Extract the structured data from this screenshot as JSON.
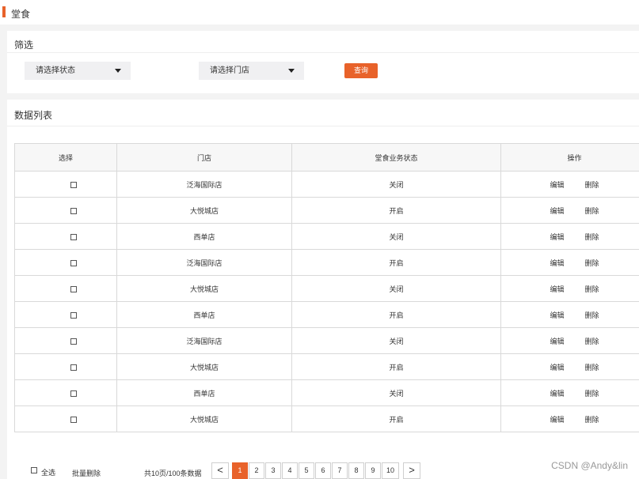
{
  "header": {
    "title": "堂食"
  },
  "filter": {
    "title": "筛选",
    "status_placeholder": "请选择状态",
    "store_placeholder": "请选择门店",
    "query_label": "查询"
  },
  "list": {
    "title": "数据列表",
    "columns": [
      "选择",
      "门店",
      "堂食业务状态",
      "操作"
    ],
    "edit_label": "编辑",
    "delete_label": "删除",
    "rows": [
      {
        "store": "泛海国际店",
        "status": "关闭"
      },
      {
        "store": "大悦城店",
        "status": "开启"
      },
      {
        "store": "西单店",
        "status": "关闭"
      },
      {
        "store": "泛海国际店",
        "status": "开启"
      },
      {
        "store": "大悦城店",
        "status": "关闭"
      },
      {
        "store": "西单店",
        "status": "开启"
      },
      {
        "store": "泛海国际店",
        "status": "关闭"
      },
      {
        "store": "大悦城店",
        "status": "开启"
      },
      {
        "store": "西单店",
        "status": "关闭"
      },
      {
        "store": "大悦城店",
        "status": "开启"
      }
    ]
  },
  "footer": {
    "select_all_label": "全选",
    "bulk_delete_label": "批量删除",
    "total_text": "共10页/100条数据",
    "prev_icon": "<",
    "next_icon": ">",
    "pages": [
      "1",
      "2",
      "3",
      "4",
      "5",
      "6",
      "7",
      "8",
      "9",
      "10"
    ],
    "current_page": "1"
  },
  "watermark": "CSDN @Andy&lin",
  "colors": {
    "accent": "#e8622a"
  }
}
